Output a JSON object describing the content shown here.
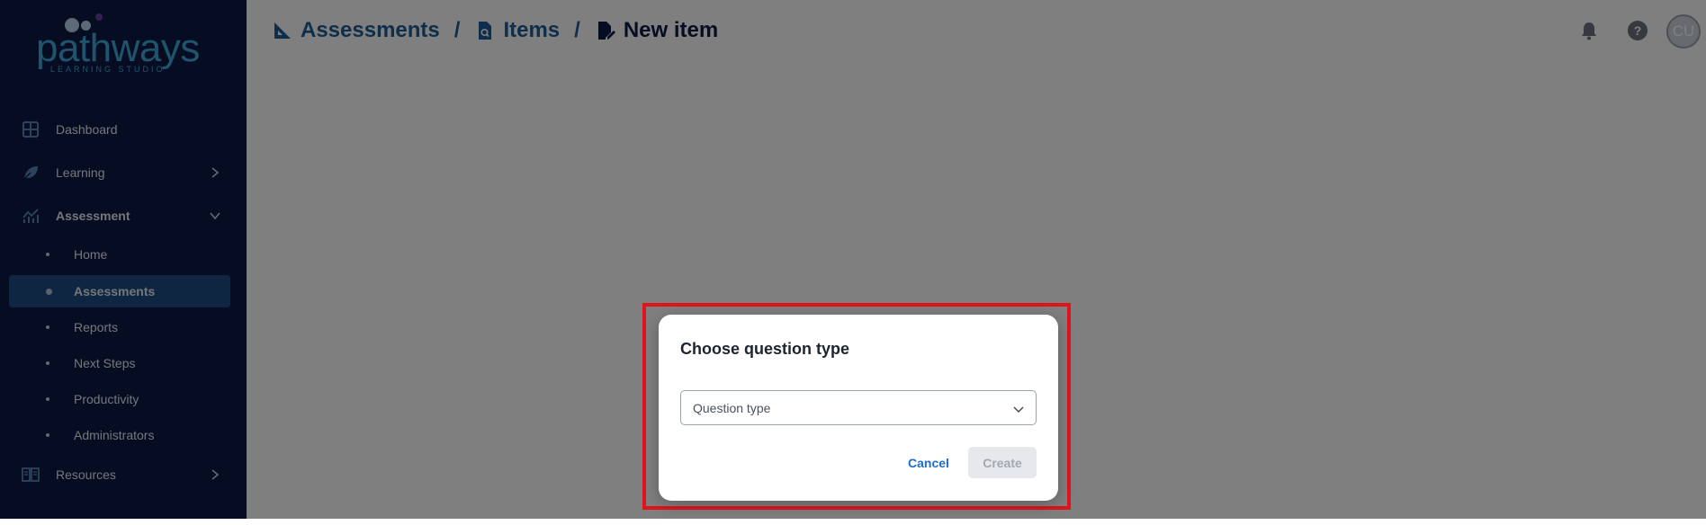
{
  "brand": {
    "name": "pathways",
    "tagline": "LEARNING STUDIO",
    "colors": {
      "logo": "#3fa8d8",
      "dot_purple": "#6b3fa0",
      "sidebar": "#0c1a45",
      "active_item": "#1f4c86"
    }
  },
  "sidebar": {
    "items": [
      {
        "label": "Dashboard",
        "icon": "dashboard-icon"
      },
      {
        "label": "Learning",
        "icon": "leaf-icon",
        "expandable": true,
        "expanded": false
      },
      {
        "label": "Assessment",
        "icon": "chart-line-icon",
        "expandable": true,
        "expanded": true
      },
      {
        "label": "Resources",
        "icon": "book-icon",
        "expandable": true,
        "expanded": false
      }
    ],
    "assessment_sub": [
      {
        "label": "Home"
      },
      {
        "label": "Assessments",
        "active": true
      },
      {
        "label": "Reports"
      },
      {
        "label": "Next Steps"
      },
      {
        "label": "Productivity"
      },
      {
        "label": "Administrators"
      }
    ]
  },
  "header": {
    "breadcrumb": [
      {
        "label": "Assessments",
        "icon": "ruler-triangle-icon"
      },
      {
        "label": "Items",
        "icon": "file-search-icon"
      },
      {
        "label": "New item",
        "icon": "file-edit-icon",
        "current": true
      }
    ],
    "separator": "/",
    "icons": [
      "bell-icon",
      "help-icon"
    ],
    "avatar_initials": "CU"
  },
  "dialog": {
    "title": "Choose question type",
    "select_placeholder": "Question type",
    "cancel_label": "Cancel",
    "create_label": "Create",
    "create_enabled": false
  }
}
